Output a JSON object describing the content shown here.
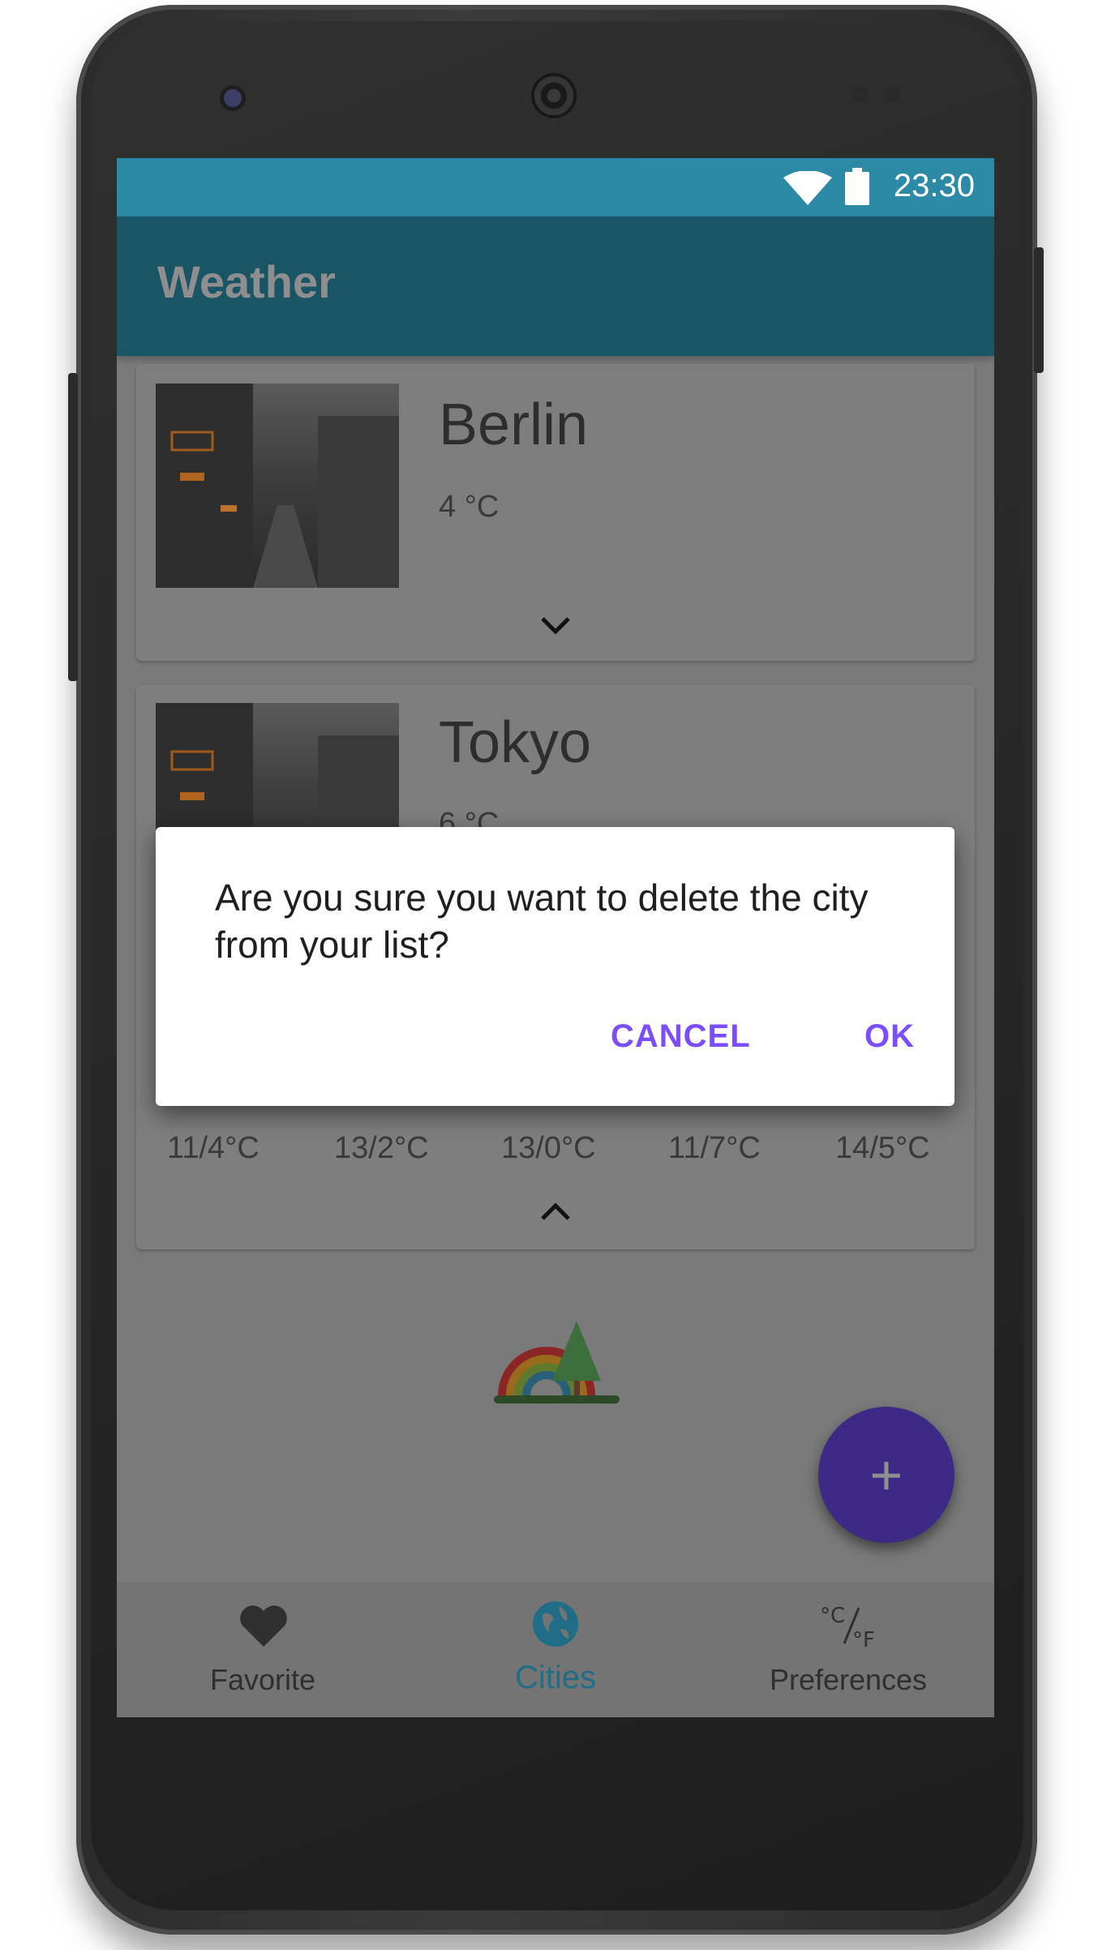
{
  "statusbar": {
    "time": "23:30",
    "icons": [
      "wifi-icon",
      "battery-icon"
    ]
  },
  "appbar": {
    "title": "Weather"
  },
  "cities": [
    {
      "name": "Berlin",
      "temperature": "4 °C",
      "expand_icon": "chevron-down-icon"
    },
    {
      "name": "Tokyo",
      "temperature": "6 °C",
      "collapse_icon": "chevron-up-icon",
      "forecast": [
        "11/4°C",
        "13/2°C",
        "13/0°C",
        "11/7°C",
        "14/5°C"
      ]
    }
  ],
  "dialog": {
    "message": "Are you sure you want to delete the city from your list?",
    "cancel_label": "CANCEL",
    "ok_label": "OK"
  },
  "fab": {
    "label": "+",
    "icon": "add-icon"
  },
  "bottom_nav": {
    "items": [
      {
        "label": "Favorite",
        "icon": "heart-icon",
        "active": false
      },
      {
        "label": "Cities",
        "icon": "globe-icon",
        "active": true
      },
      {
        "label": "Preferences",
        "icon": "celsius-fahrenheit-icon",
        "active": false
      }
    ]
  },
  "colors": {
    "statusbar": "#2d8aa6",
    "appbar": "#1a5565",
    "accent": "#7b4dff",
    "fab": "#3c2a86",
    "nav_active": "#1f6d87"
  }
}
